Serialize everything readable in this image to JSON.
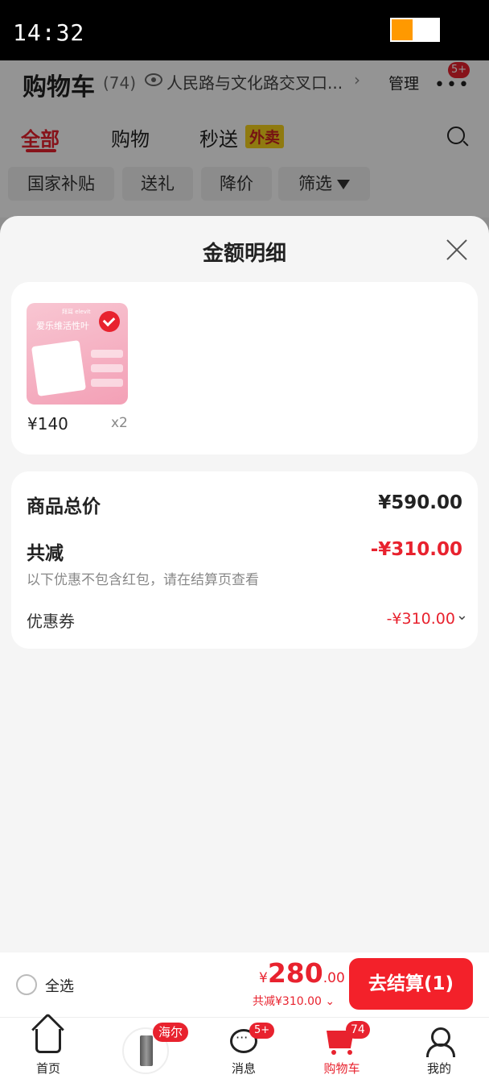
{
  "status_bar": {
    "time": "14:32",
    "battery_level": 0.45
  },
  "cart_page": {
    "title": "购物车",
    "count": "(74)",
    "address": "人民路与文化路交叉口...",
    "manage_label": "管理",
    "more_badge": "5+",
    "tabs": [
      {
        "label": "全部",
        "active": true
      },
      {
        "label": "购物",
        "active": false
      },
      {
        "label": "秒送",
        "active": false
      }
    ],
    "takeaway_badge": "外卖",
    "filter_chips": [
      "国家补贴",
      "送礼",
      "降价",
      "筛选"
    ]
  },
  "sheet": {
    "title": "金额明细",
    "item": {
      "price": "¥140",
      "quantity": "x2",
      "thumb_text": "爱乐维活性叶",
      "thumb_brand": "拜耳 elevit"
    },
    "summary": {
      "total_label": "商品总价",
      "total_value": "¥590.00",
      "reduce_label": "共减",
      "reduce_value": "-¥310.00",
      "reduce_note": "以下优惠不包含红包，请在结算页查看",
      "coupon_label": "优惠券",
      "coupon_value": "-¥310.00"
    }
  },
  "checkout": {
    "select_all_label": "全选",
    "price_currency": "¥",
    "price_integer": "280",
    "price_decimal": ".00",
    "discount_text": "共减¥310.00 ⌄",
    "button_label": "去结算(1)"
  },
  "bottom_nav": {
    "home_label": "首页",
    "haier_badge": "海尔",
    "messages_label": "消息",
    "messages_badge": "5+",
    "cart_label": "购物车",
    "cart_badge": "74",
    "me_label": "我的"
  },
  "colors": {
    "accent": "#e8222e",
    "checkout_button": "#f3212a",
    "takeaway_badge": "#f6d21d"
  }
}
